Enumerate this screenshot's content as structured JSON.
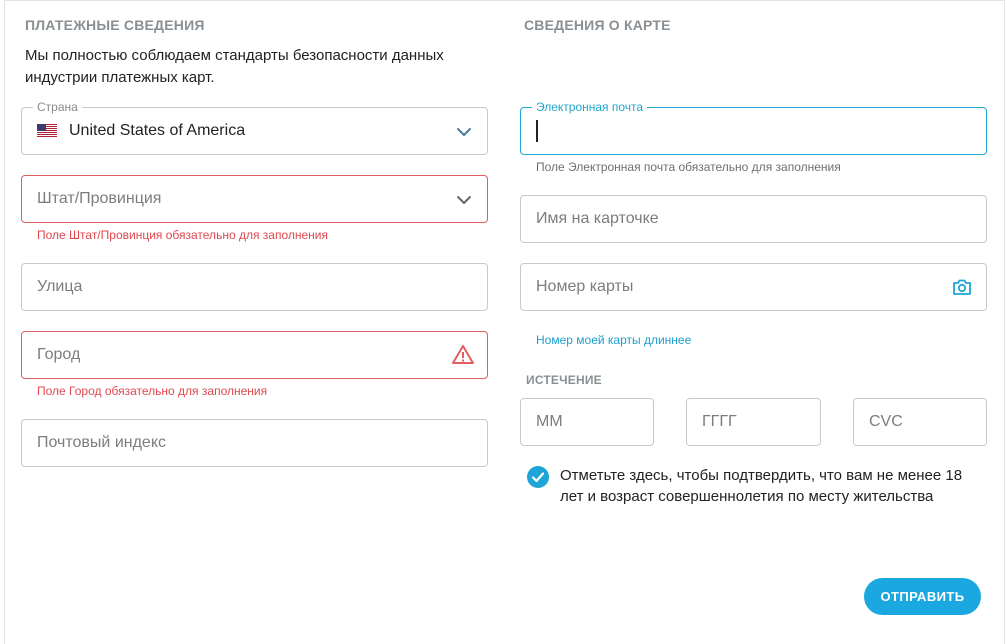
{
  "billing": {
    "title": "ПЛАТЕЖНЫЕ СВЕДЕНИЯ",
    "intro": "Мы полностью соблюдаем стандарты безопасности данных индустрии платежных карт.",
    "country": {
      "legend": "Страна",
      "value": "United States of America",
      "icon": "us-flag-icon"
    },
    "state": {
      "placeholder": "Штат/Провинция",
      "error": "Поле Штат/Провинция обязательно для заполнения"
    },
    "street": {
      "placeholder": "Улица"
    },
    "city": {
      "placeholder": "Город",
      "error": "Поле Город обязательно для заполнения"
    },
    "postal": {
      "placeholder": "Почтовый индекс"
    }
  },
  "card": {
    "title": "СВЕДЕНИЯ О КАРТЕ",
    "email": {
      "legend": "Электронная почта",
      "hint": "Поле Электронная почта обязательно для заполнения"
    },
    "name": {
      "placeholder": "Имя на карточке"
    },
    "number": {
      "placeholder": "Номер карты",
      "icon": "camera-icon",
      "link": "Номер моей карты длиннее"
    },
    "expiry": {
      "title": "ИСТЕЧЕНИЕ",
      "month": "ММ",
      "year": "ГГГГ",
      "cvc": "CVC"
    },
    "age_confirm": {
      "checked": true,
      "label": "Отметьте здесь, чтобы подтвердить, что вам не менее 18 лет и возраст совершеннолетия по месту жительства"
    },
    "submit": "ОТПРАВИТЬ"
  },
  "colors": {
    "accent": "#1ba8e0",
    "error": "#e25c63",
    "focus": "#20a7cf"
  }
}
